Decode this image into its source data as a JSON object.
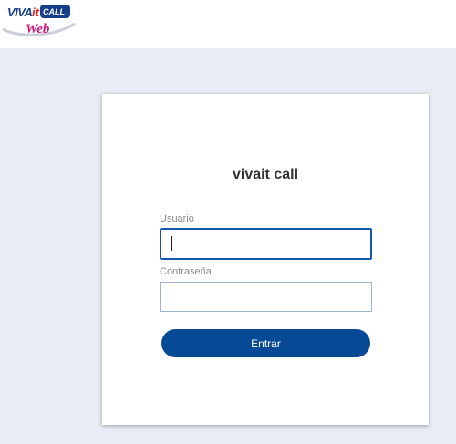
{
  "header": {
    "logo": {
      "brand_text": "VIVAit CALL",
      "sub_text": "Web"
    }
  },
  "login": {
    "title": "vivait call",
    "username": {
      "label": "Usuario",
      "value": ""
    },
    "password": {
      "label": "Contraseña",
      "value": ""
    },
    "submit_label": "Entrar"
  },
  "colors": {
    "page_background": "#e8edf5",
    "header_background": "#ffffff",
    "primary_button": "#064a95",
    "focus_border": "#1658a8",
    "input_border": "#9bb3cf",
    "title_text": "#333333",
    "label_text": "#8a8a8a",
    "logo_red": "#e3262a",
    "logo_blue": "#153f8a",
    "logo_magenta": "#d3177d"
  }
}
